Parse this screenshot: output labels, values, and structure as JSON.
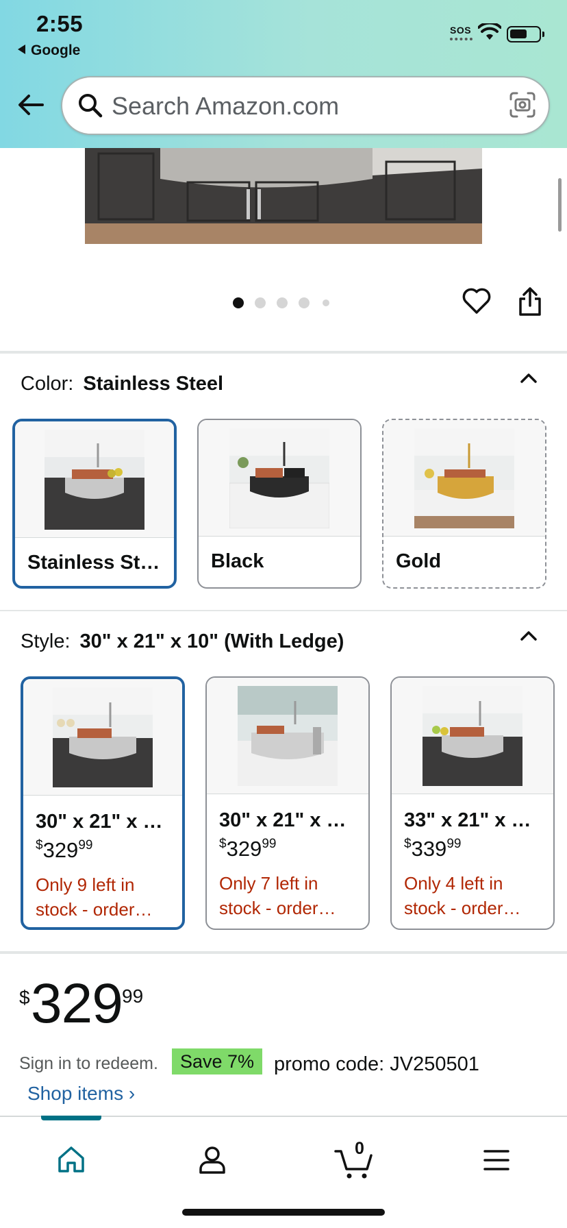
{
  "status_bar": {
    "time": "2:55",
    "back_app": "Google",
    "sos": "SOS"
  },
  "header": {
    "search_placeholder": "Search Amazon.com",
    "back_icon": "back-arrow-icon",
    "search_icon": "search-icon",
    "camera_icon": "camera-scan-icon"
  },
  "gallery": {
    "dot_count": 5,
    "active_dot": 1
  },
  "color_section": {
    "label": "Color:",
    "selected": "Stainless Steel",
    "options": [
      {
        "name": "Stainless St…",
        "finish": "stainless"
      },
      {
        "name": "Black",
        "finish": "black"
      },
      {
        "name": "Gold",
        "finish": "gold"
      }
    ]
  },
  "style_section": {
    "label": "Style:",
    "selected": "30\" x 21\" x 10\" (With Ledge)",
    "options": [
      {
        "name": "30\" x 21\" x …",
        "currency": "$",
        "whole": "329",
        "cents": "99",
        "stock_line1": "Only 9 left in",
        "stock_line2": "stock - order…"
      },
      {
        "name": "30\" x 21\" x …",
        "currency": "$",
        "whole": "329",
        "cents": "99",
        "stock_line1": "Only 7 left in",
        "stock_line2": "stock - order…"
      },
      {
        "name": "33\" x 21\" x …",
        "currency": "$",
        "whole": "339",
        "cents": "99",
        "stock_line1": "Only 4 left in",
        "stock_line2": "stock - order…"
      }
    ]
  },
  "price": {
    "currency": "$",
    "whole": "329",
    "cents": "99"
  },
  "promo": {
    "sign_in": "Sign in to redeem.",
    "badge": "Save 7%",
    "code": "promo code: JV250501",
    "shop_items": "Shop items ›"
  },
  "bottom_nav": {
    "cart_count": "0"
  },
  "colors": {
    "selected_border": "#2162a1",
    "stock_red": "#b12704",
    "promo_green": "#7fda69",
    "link_blue": "#2162a1",
    "nav_active": "#007185"
  }
}
